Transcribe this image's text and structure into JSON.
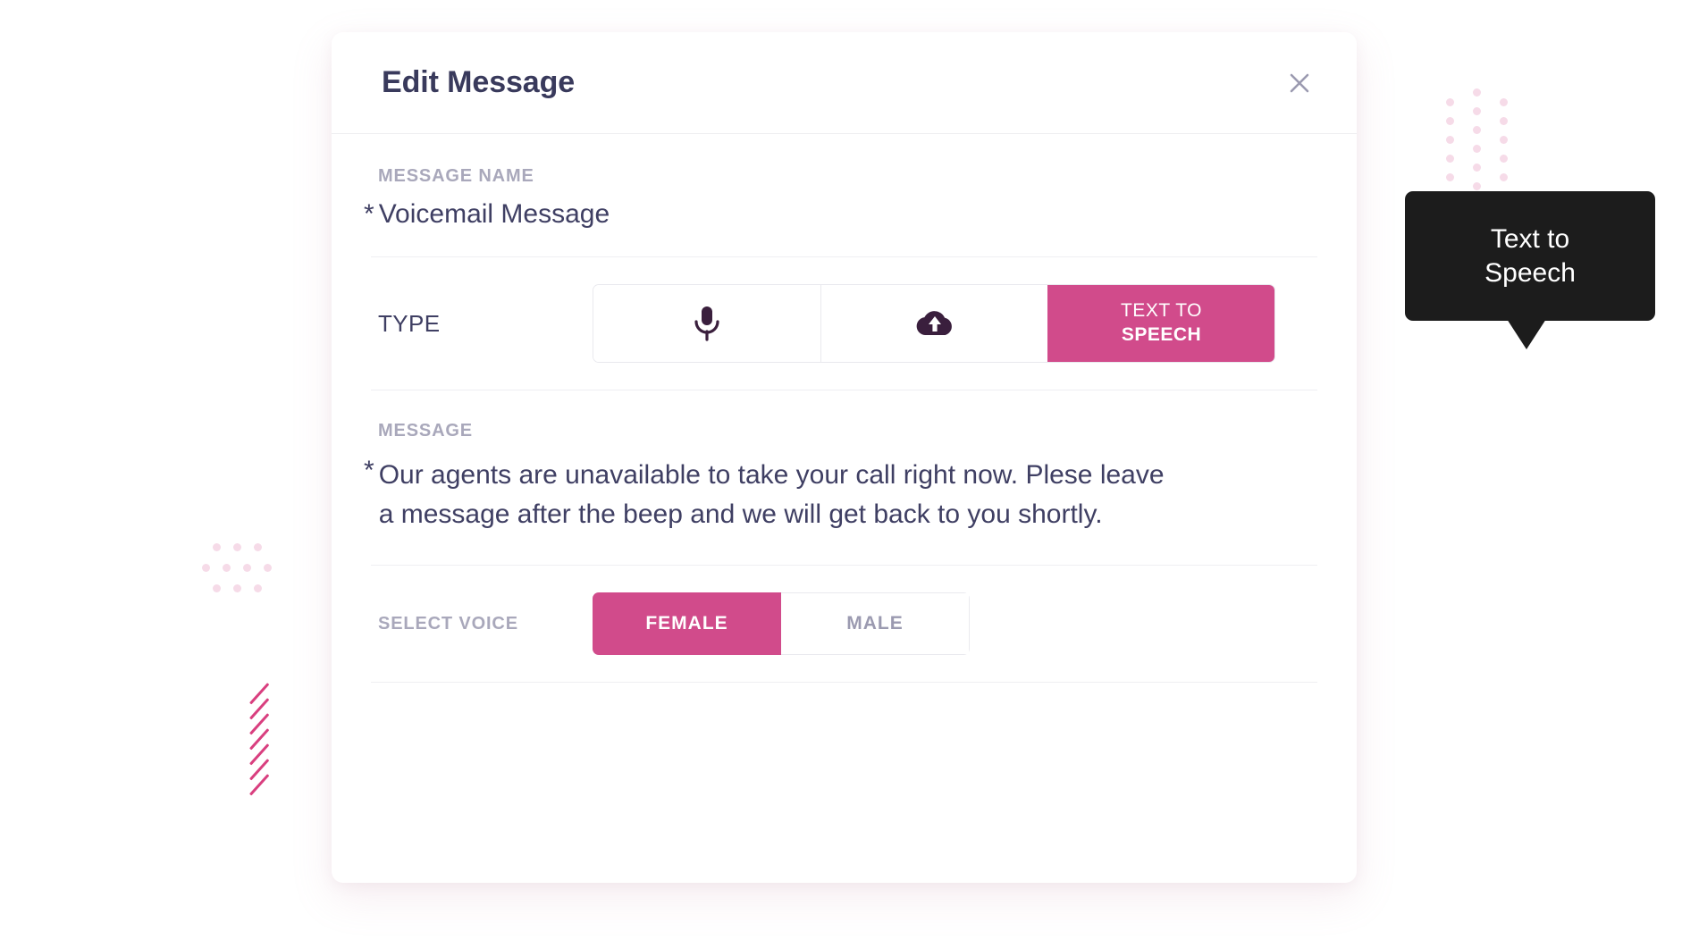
{
  "dialog": {
    "title": "Edit Message",
    "close_icon": "close-icon"
  },
  "message_name": {
    "label": "MESSAGE NAME",
    "required_marker": "*",
    "value": "Voicemail Message"
  },
  "type": {
    "label": "TYPE",
    "options": [
      {
        "id": "record",
        "icon": "microphone-icon",
        "label": "",
        "active": false
      },
      {
        "id": "upload",
        "icon": "cloud-upload-icon",
        "label": "",
        "active": false
      },
      {
        "id": "text-to-speech",
        "icon": "",
        "label_line1": "TEXT TO",
        "label_line2": "SPEECH",
        "active": true
      }
    ]
  },
  "message": {
    "label": "MESSAGE",
    "required_marker": "*",
    "value": "Our agents are unavailable to take your call right now. Plese leave a message after the beep and we will get back to you shortly."
  },
  "voice": {
    "label": "SELECT VOICE",
    "options": [
      {
        "id": "female",
        "label": "FEMALE",
        "active": true
      },
      {
        "id": "male",
        "label": "MALE",
        "active": false
      }
    ]
  },
  "tooltip": {
    "text": "Text to\nSpeech"
  },
  "colors": {
    "accent_pink": "#d14b8b",
    "text_dark": "#3f3f63",
    "label_gray": "#a9a8bb",
    "tooltip_bg": "#1c1c1c",
    "deco_dot": "#f6dbe8",
    "deco_slash": "#d93f7f"
  }
}
